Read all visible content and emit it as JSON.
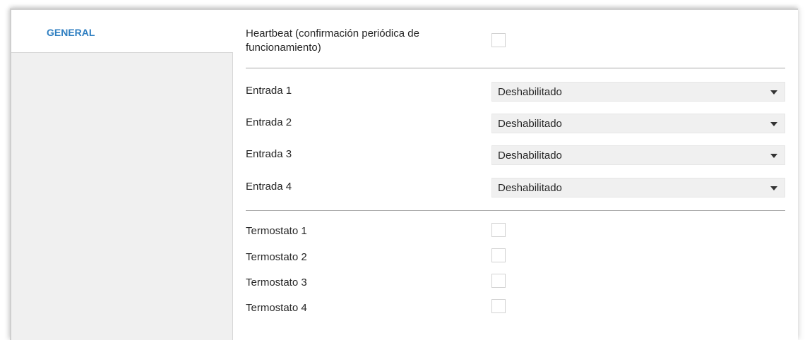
{
  "sidebar": {
    "items": [
      {
        "label": "GENERAL"
      }
    ]
  },
  "heartbeat": {
    "label_line1": "Heartbeat (confirmación periódica de",
    "label_line2": "funcionamiento)"
  },
  "entradas": [
    {
      "label": "Entrada 1",
      "value": "Deshabilitado"
    },
    {
      "label": "Entrada 2",
      "value": "Deshabilitado"
    },
    {
      "label": "Entrada 3",
      "value": "Deshabilitado"
    },
    {
      "label": "Entrada 4",
      "value": "Deshabilitado"
    }
  ],
  "termostatos": [
    {
      "label": "Termostato 1"
    },
    {
      "label": "Termostato 2"
    },
    {
      "label": "Termostato 3"
    },
    {
      "label": "Termostato 4"
    }
  ],
  "colors": {
    "accent": "#2f7fc1",
    "sidebar_bg": "#f0f0f0",
    "select_bg": "#f0f0f0",
    "divider": "#a8a8a8"
  }
}
